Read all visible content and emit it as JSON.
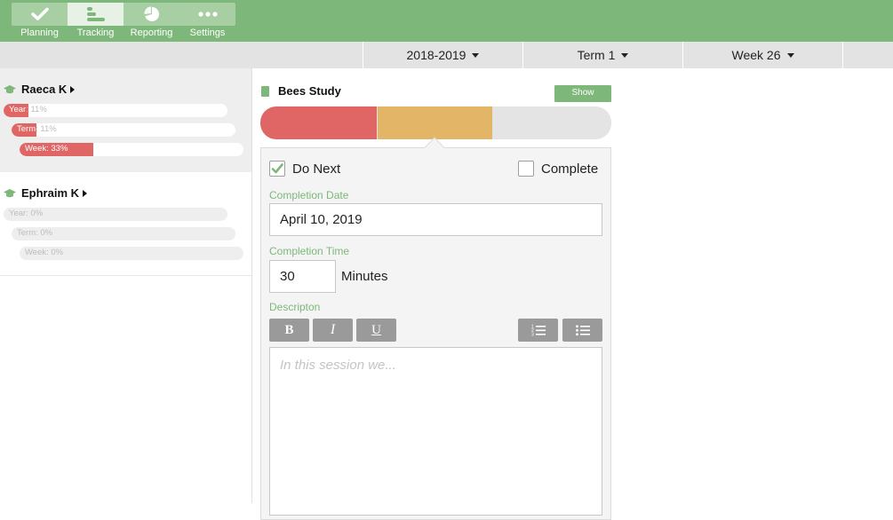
{
  "nav": {
    "items": [
      {
        "label": "Planning",
        "icon": "checkmark-icon"
      },
      {
        "label": "Tracking",
        "icon": "tracking-bars-icon",
        "active": true
      },
      {
        "label": "Reporting",
        "icon": "pie-chart-icon"
      },
      {
        "label": "Settings",
        "icon": "dots-icon"
      }
    ]
  },
  "filters": {
    "year": "2018-2019",
    "term": "Term 1",
    "week": "Week 26"
  },
  "students": [
    {
      "name": "Raeca K",
      "progress": [
        {
          "prefix": "Year",
          "suffix": ": 11%",
          "percent": 11
        },
        {
          "prefix": "Term",
          "suffix": ": 11%",
          "percent": 11
        },
        {
          "prefix": "Week: 33%",
          "suffix": "",
          "percent": 33
        }
      ]
    },
    {
      "name": "Ephraim K",
      "progress": [
        {
          "prefix": "",
          "suffix": "Year: 0%",
          "percent": 0
        },
        {
          "prefix": "",
          "suffix": "Term: 0%",
          "percent": 0
        },
        {
          "prefix": "",
          "suffix": "Week: 0%",
          "percent": 0
        }
      ]
    }
  ],
  "panel": {
    "title": "Bees Study",
    "show_button": "Show"
  },
  "colors": {
    "accent": "#7db87a",
    "seg_red": "#e06666",
    "seg_orange": "#e3b567",
    "seg_grey": "#e4e4e4"
  },
  "editor": {
    "do_next_label": "Do Next",
    "do_next_checked": true,
    "complete_label": "Complete",
    "complete_checked": false,
    "completion_date_label": "Completion Date",
    "completion_date_value": "April 10, 2019",
    "completion_time_label": "Completion Time",
    "completion_time_value": "30",
    "completion_time_unit": "Minutes",
    "description_label": "Descripton",
    "description_placeholder": "In this session we...",
    "toolbar": {
      "bold": "B",
      "italic": "I",
      "underline": "U"
    }
  }
}
